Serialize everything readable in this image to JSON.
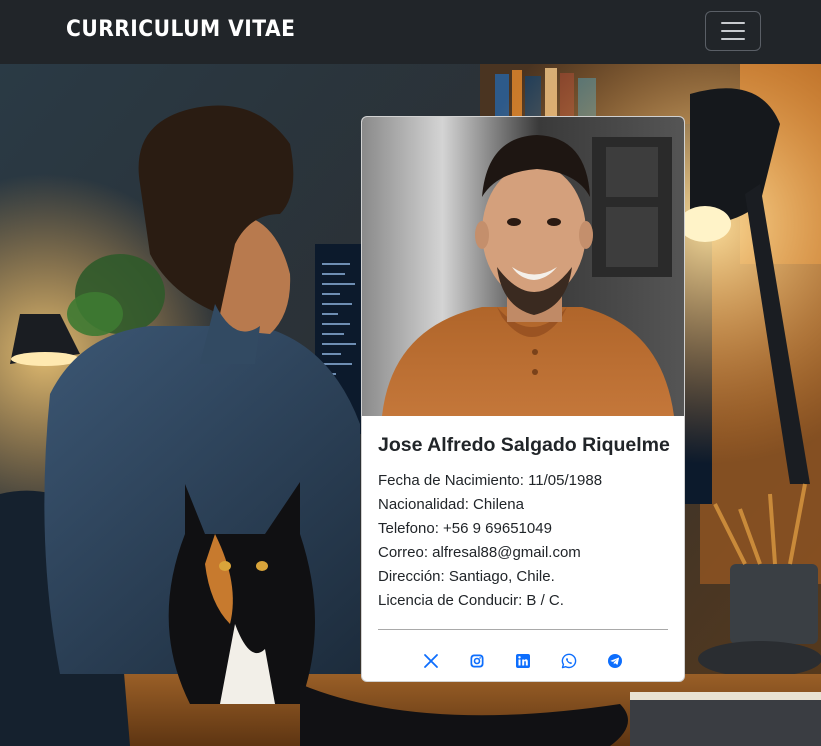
{
  "navbar": {
    "brand": "CURRICULUM VITAE",
    "toggler_icon": "hamburger-menu-icon"
  },
  "profile": {
    "name": "Jose Alfredo Salgado Riquelme",
    "fields": [
      "Fecha de Nacimiento: 11/05/1988",
      "Nacionalidad: Chilena",
      "Telefono: +56 9 69651049",
      "Correo: alfresal88@gmail.com",
      "Dirección: Santiago, Chile.",
      "Licencia de Conducir: B / C."
    ],
    "social_icons": [
      "x-icon",
      "instagram-icon",
      "linkedin-icon",
      "whatsapp-icon",
      "telegram-icon"
    ]
  },
  "colors": {
    "navbar_bg": "#212529",
    "link_blue": "#0d6efd",
    "card_bg": "#ffffff"
  }
}
